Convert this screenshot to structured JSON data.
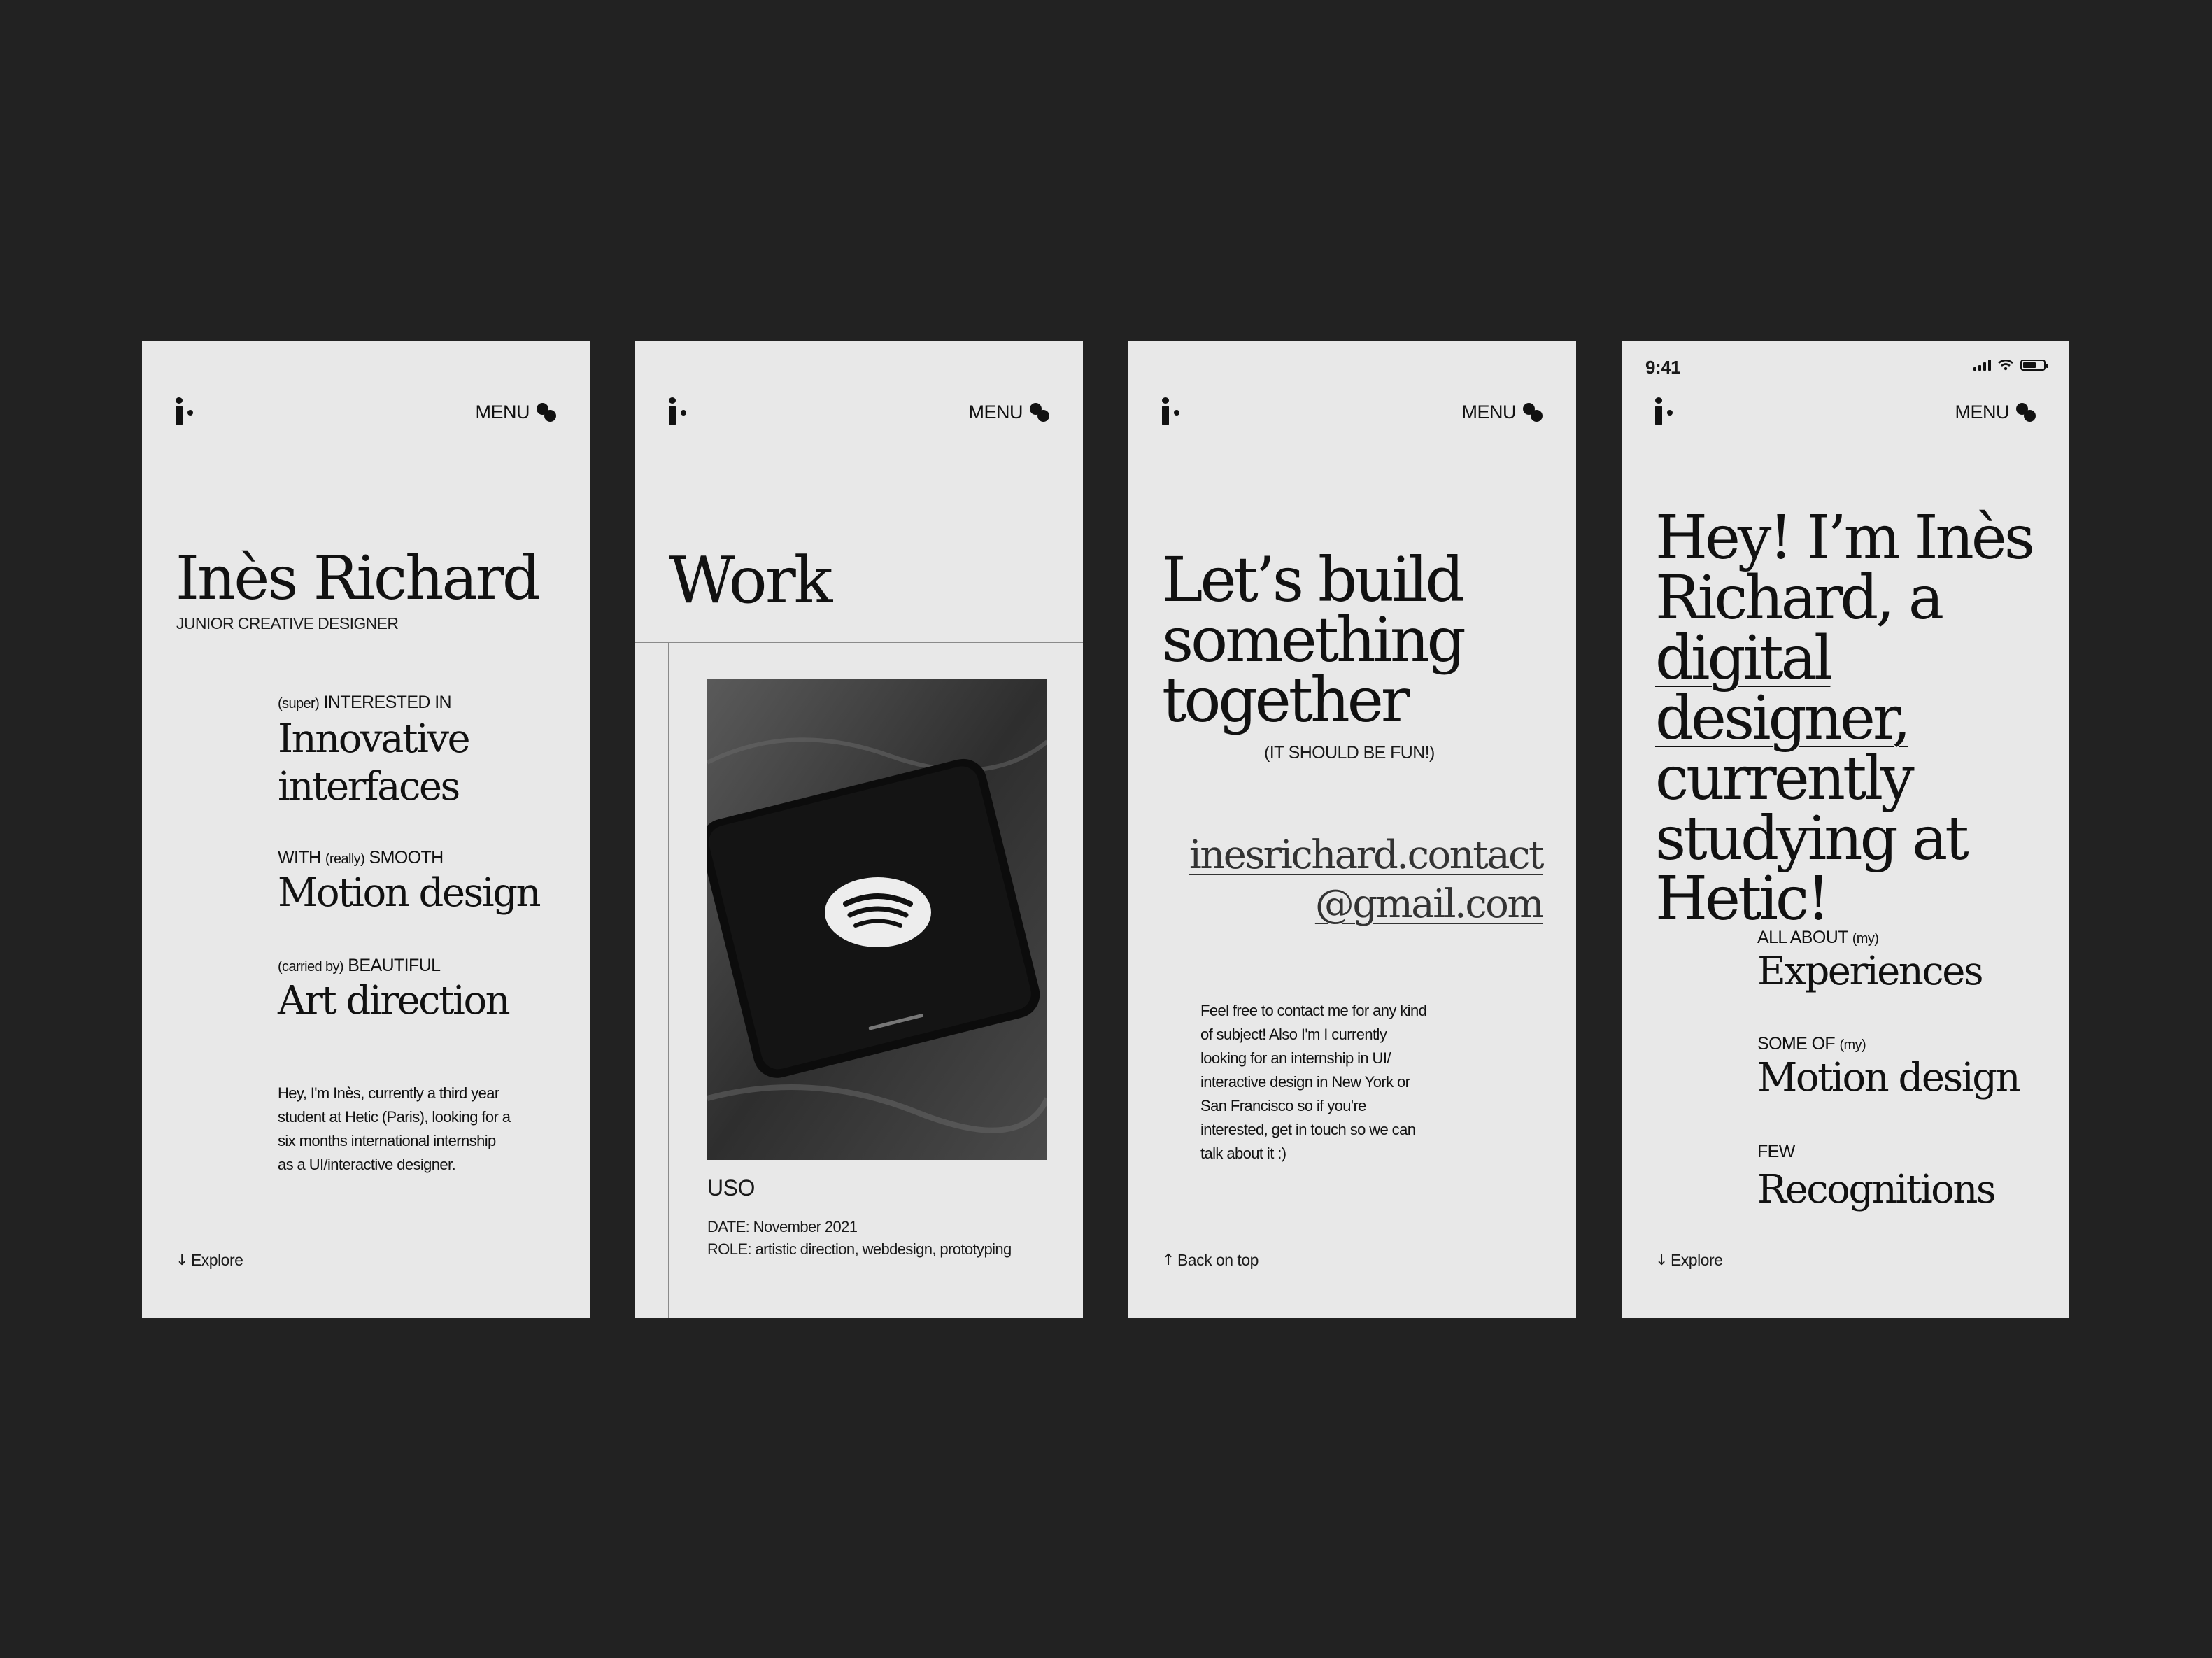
{
  "common": {
    "menu_label": "MENU"
  },
  "screen1": {
    "name": "Inès Richard",
    "subtitle": "JUNIOR CREATIVE DESIGNER",
    "items": [
      {
        "pre": "(super)",
        "kicker": "INTERESTED IN",
        "post": "",
        "title_line1": "Innovative",
        "title_line2": "interfaces"
      },
      {
        "kicker": "WITH",
        "mid": "(really)",
        "kicker2": "SMOOTH",
        "title": "Motion design"
      },
      {
        "pre": "(carried by)",
        "kicker": "BEAUTIFUL",
        "title": "Art direction"
      }
    ],
    "intro_lines": [
      "Hey, I'm Inès, currently a third year",
      "student at Hetic (Paris), looking for a",
      "six months international internship",
      "as a UI/interactive designer."
    ],
    "explore_label": "Explore",
    "explore_icon": "arrow-down-icon"
  },
  "screen2": {
    "title": "Work",
    "project": {
      "name": "USO",
      "date": "DATE: November 2021",
      "role": "ROLE: artistic direction, webdesign, prototyping"
    }
  },
  "screen3": {
    "title_lines": [
      "Let’s build",
      "something",
      "together"
    ],
    "note": "(IT SHOULD BE FUN!)",
    "email_line1": "inesrichard.contact",
    "email_line2": "@gmail.com",
    "para_lines": [
      "Feel free to contact me for any kind",
      "of subject! Also I'm I currently",
      "looking for an internship in UI/",
      "interactive design in New York or",
      "San Francisco so if you're",
      "interested, get in touch so we can",
      "talk about it :)"
    ],
    "back_label": "Back on top",
    "back_icon": "arrow-up-icon"
  },
  "screen4": {
    "status_time": "9:41",
    "title_lines": [
      "Hey! I’m Inès",
      "Richard, a",
      "digital designer,",
      "currently",
      "studying at",
      "Hetic!"
    ],
    "sections": [
      {
        "kicker": "ALL ABOUT",
        "small": "(my)",
        "title": "Experiences"
      },
      {
        "kicker": "SOME OF",
        "small": "(my)",
        "title": "Motion design"
      },
      {
        "kicker": "FEW",
        "small": "",
        "title": "Recognitions"
      }
    ],
    "explore_label": "Explore"
  }
}
